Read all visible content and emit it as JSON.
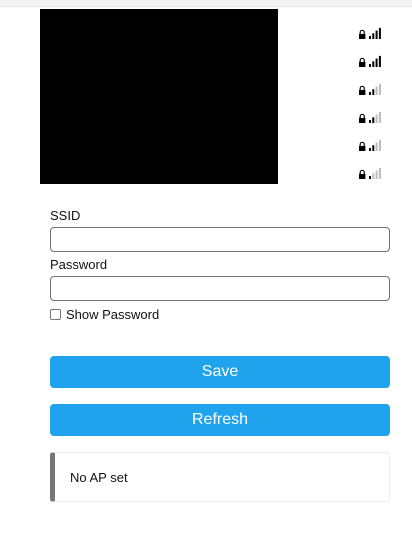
{
  "networks": [
    {
      "locked": true,
      "strength": 4
    },
    {
      "locked": true,
      "strength": 4
    },
    {
      "locked": true,
      "strength": 2
    },
    {
      "locked": true,
      "strength": 2
    },
    {
      "locked": true,
      "strength": 2
    },
    {
      "locked": true,
      "strength": 1
    }
  ],
  "form": {
    "ssid_label": "SSID",
    "ssid_value": "",
    "password_label": "Password",
    "password_value": "",
    "show_password_label": "Show Password"
  },
  "buttons": {
    "save_label": "Save",
    "refresh_label": "Refresh"
  },
  "status": {
    "message": "No AP set"
  },
  "colors": {
    "accent": "#1fa3ec",
    "bar_active": "#000000",
    "bar_inactive": "#bbbbbb",
    "status_border": "#777777"
  }
}
